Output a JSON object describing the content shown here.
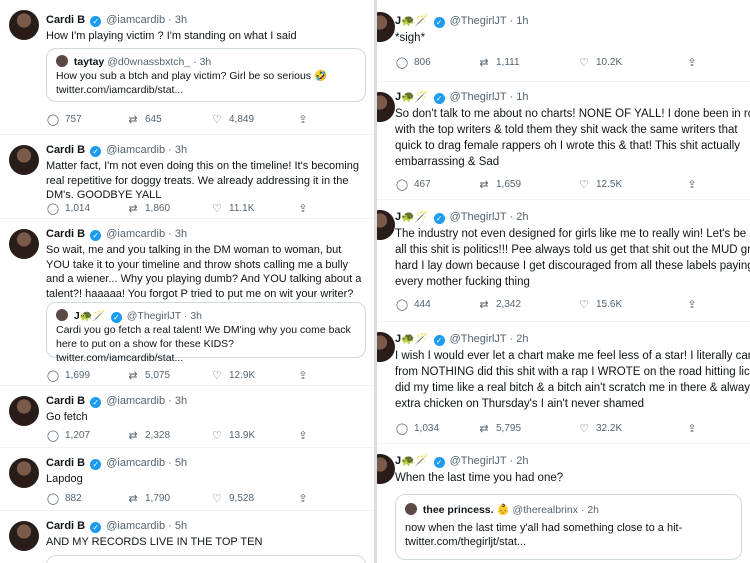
{
  "left": {
    "tweets": [
      {
        "name": "Cardi B",
        "handle": "@iamcardib",
        "time": "3h",
        "text": "How I'm playing victim ? I'm standing on what I said",
        "quote": {
          "name": "taytay",
          "handle": "@d0wnassbxtch_",
          "time": "3h",
          "text": "How you sub a btch and play victim? Girl be so serious 🤣",
          "link": "twitter.com/iamcardib/stat..."
        },
        "replies": "757",
        "retweets": "645",
        "likes": "4,849"
      },
      {
        "name": "Cardi B",
        "handle": "@iamcardib",
        "time": "3h",
        "text": "Matter fact, I'm not even doing this on the timeline! It's becoming real repetitive for doggy treats. We already addressing it in the DM's. GOODBYE YALL",
        "replies": "1,014",
        "retweets": "1,860",
        "likes": "11.1K"
      },
      {
        "name": "Cardi B",
        "handle": "@iamcardib",
        "time": "3h",
        "text": "So wait, me and you talking in the DM woman to woman, but YOU take it to your timeline and throw shots calling me a bully and a wiener... Why you playing dumb? And YOU talking about a talent?! haaaaa! You forgot P tried to put me on wit your writer?",
        "quote": {
          "name": "J🐢🪄",
          "handle": "@ThegirlJT",
          "time": "3h",
          "text": "Cardi you go fetch a real talent! We DM'ing why you come back here to put on a show for these KIDS?",
          "link": "twitter.com/iamcardib/stat..."
        },
        "replies": "1,699",
        "retweets": "5,075",
        "likes": "12.9K"
      },
      {
        "name": "Cardi B",
        "handle": "@iamcardib",
        "time": "3h",
        "text": "Go fetch",
        "replies": "1,207",
        "retweets": "2,328",
        "likes": "13.9K"
      },
      {
        "name": "Cardi B",
        "handle": "@iamcardib",
        "time": "5h",
        "text": "Lapdog",
        "replies": "882",
        "retweets": "1,790",
        "likes": "9,528"
      },
      {
        "name": "Cardi B",
        "handle": "@iamcardib",
        "time": "5h",
        "text": "AND MY RECORDS LIVE IN THE TOP TEN"
      }
    ]
  },
  "right": {
    "tweets": [
      {
        "name": "J🐢🪄",
        "handle": "@ThegirlJT",
        "time": "1h",
        "lines": [
          "*sigh*"
        ],
        "replies": "806",
        "retweets": "1,111",
        "likes": "10.2K"
      },
      {
        "name": "J🐢🪄",
        "handle": "@ThegirlJT",
        "time": "1h",
        "lines": [
          "So don't talk to me about no charts! NONE OF YALL! I done been in roo",
          "with the top writers & told them they shit wack the same writers that",
          "quick to drag female rappers oh I wrote this & that! This shit actually",
          "embarrassing & Sad"
        ],
        "replies": "467",
        "retweets": "1,659",
        "likes": "12.5K"
      },
      {
        "name": "J🐢🪄",
        "handle": "@ThegirlJT",
        "time": "2h",
        "lines": [
          "The industry not even designed for girls like me to really win! Let's be re",
          "all this shit is politics!!! Pee always told us get that shit out the MUD gr",
          "hard I lay down because I get discouraged from all these labels paying t",
          "every mother fucking thing"
        ],
        "replies": "444",
        "retweets": "2,342",
        "likes": "15.6K"
      },
      {
        "name": "J🐢🪄",
        "handle": "@ThegirlJT",
        "time": "2h",
        "lines": [
          "I wish I would ever let a chart make me feel less of a star! I literally cam",
          "from NOTHING did this shit with a rap I WROTE on the road hitting licks",
          "did my time like a real bitch & a bitch ain't scratch me in there & always",
          "extra chicken on Thursday's I ain't never shamed"
        ],
        "replies": "1,034",
        "retweets": "5,795",
        "likes": "32.2K"
      },
      {
        "name": "J🐢🪄",
        "handle": "@ThegirlJT",
        "time": "2h",
        "lines": [
          "When the last time you had one?"
        ],
        "quote": {
          "name": "thee princess. 👶",
          "handle": "@therealbrinx",
          "time": "2h",
          "text": "now when the last time y'all had something close to a hit-",
          "link": "twitter.com/thegirljt/stat..."
        }
      }
    ]
  },
  "icons": {
    "reply": "reply-icon",
    "retweet": "retweet-icon",
    "like": "heart-icon",
    "share": "share-icon",
    "verified": "verified-badge-icon"
  }
}
